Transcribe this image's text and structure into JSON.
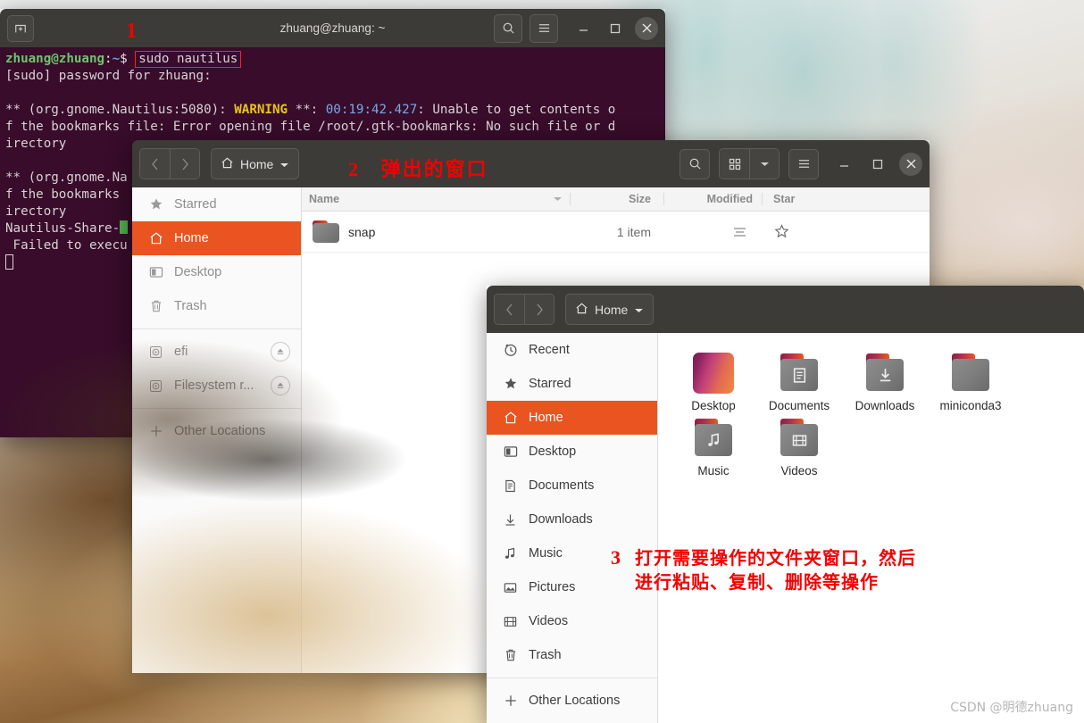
{
  "terminal": {
    "title": "zhuang@zhuang: ~",
    "new_tab_icon": "new-tab-icon",
    "search_icon": "search-icon",
    "menu_icon": "hamburger-menu-icon",
    "minimize_icon": "minimize-icon",
    "maximize_icon": "maximize-icon",
    "close_icon": "close-icon",
    "prompt_user": "zhuang@zhuang",
    "prompt_sep": ":",
    "prompt_path": "~",
    "prompt_dollar": "$",
    "command": "sudo nautilus",
    "line_password": "[sudo] password for zhuang:",
    "warn_prefix": "** (org.gnome.Nautilus:5080): ",
    "warn_word": "WARNING",
    "warn_mid": " **: ",
    "warn_time": "00:19:42.427",
    "warn_rest": ": Unable to get contents o",
    "warn_line2": "f the bookmarks file: Error opening file /root/.gtk-bookmarks: No such file or d",
    "warn_line3": "irectory",
    "warn2_prefix": "** (org.gnome.Na",
    "warn2_line2": "f the bookmarks ",
    "warn2_line3": "irectory",
    "share_line": "Nautilus-Share-",
    "failed_line": " Failed to execu"
  },
  "annotations": {
    "one": "1",
    "two_num": "2",
    "two_text": "弹出的窗口",
    "three_num": "3",
    "three_line1": "打开需要操作的文件夹窗口，然后",
    "three_line2": "进行粘贴、复制、删除等操作"
  },
  "window1": {
    "back_icon": "chevron-left-icon",
    "forward_icon": "chevron-right-icon",
    "path_icon": "home-icon",
    "path_label": "Home",
    "path_chevron": "chevron-down-icon",
    "search_icon": "search-icon",
    "viewgrid_icon": "grid-view-icon",
    "viewdrop_icon": "chevron-down-icon",
    "menu_icon": "hamburger-menu-icon",
    "minimize_icon": "minimize-icon",
    "maximize_icon": "maximize-icon",
    "close_icon": "close-icon",
    "sidebar": [
      {
        "label": "Starred",
        "icon": "star-icon",
        "selected": false,
        "muted": true,
        "eject": false
      },
      {
        "label": "Home",
        "icon": "home-icon",
        "selected": true,
        "muted": false,
        "eject": false
      },
      {
        "label": "Desktop",
        "icon": "desktop-icon",
        "selected": false,
        "muted": true,
        "eject": false
      },
      {
        "label": "Trash",
        "icon": "trash-icon",
        "selected": false,
        "muted": true,
        "eject": false
      },
      {
        "sep": true
      },
      {
        "label": "efi",
        "icon": "disk-icon",
        "selected": false,
        "muted": true,
        "eject": true
      },
      {
        "label": "Filesystem r...",
        "icon": "disk-icon",
        "selected": false,
        "muted": true,
        "eject": true
      },
      {
        "sep": true
      },
      {
        "label": "Other Locations",
        "icon": "plus-icon",
        "selected": false,
        "muted": true,
        "eject": false
      }
    ],
    "columns": [
      "Name",
      "Size",
      "Modified",
      "Star"
    ],
    "sort_icon": "sort-descending-icon",
    "rows": [
      {
        "name": "snap",
        "icon": "folder-icon",
        "size": "1 item",
        "modified_icon": "list-lines-icon",
        "star_icon": "star-outline-icon"
      }
    ]
  },
  "window2": {
    "back_icon": "chevron-left-icon",
    "forward_icon": "chevron-right-icon",
    "path_icon": "home-icon",
    "path_label": "Home",
    "path_chevron": "chevron-down-icon",
    "sidebar": [
      {
        "label": "Recent",
        "icon": "clock-icon",
        "selected": false
      },
      {
        "label": "Starred",
        "icon": "star-icon",
        "selected": false
      },
      {
        "label": "Home",
        "icon": "home-icon",
        "selected": true
      },
      {
        "label": "Desktop",
        "icon": "desktop-icon",
        "selected": false
      },
      {
        "label": "Documents",
        "icon": "document-icon",
        "selected": false
      },
      {
        "label": "Downloads",
        "icon": "download-icon",
        "selected": false
      },
      {
        "label": "Music",
        "icon": "music-icon",
        "selected": false
      },
      {
        "label": "Pictures",
        "icon": "picture-icon",
        "selected": false
      },
      {
        "label": "Videos",
        "icon": "video-icon",
        "selected": false
      },
      {
        "label": "Trash",
        "icon": "trash-icon",
        "selected": false
      },
      {
        "sep": true
      },
      {
        "label": "Other Locations",
        "icon": "plus-icon",
        "selected": false
      }
    ],
    "items": [
      {
        "label": "Desktop",
        "icon": "desktop-wallpaper-icon",
        "kind": "wallpaper"
      },
      {
        "label": "Documents",
        "icon": "folder-documents-icon",
        "kind": "folder",
        "glyph": "document"
      },
      {
        "label": "Downloads",
        "icon": "folder-downloads-icon",
        "kind": "folder",
        "glyph": "download"
      },
      {
        "label": "miniconda3",
        "icon": "folder-icon",
        "kind": "folder",
        "glyph": "none"
      },
      {
        "label": "Music",
        "icon": "folder-music-icon",
        "kind": "folder",
        "glyph": "music"
      },
      {
        "label": "Videos",
        "icon": "folder-videos-icon",
        "kind": "folder",
        "glyph": "video"
      }
    ]
  },
  "watermark": "CSDN @明德zhuang",
  "colors": {
    "accent": "#e95420",
    "terminal_bg": "#380c2a",
    "titlebar_bg": "#3c3b37",
    "annotation_red": "#f40000"
  }
}
